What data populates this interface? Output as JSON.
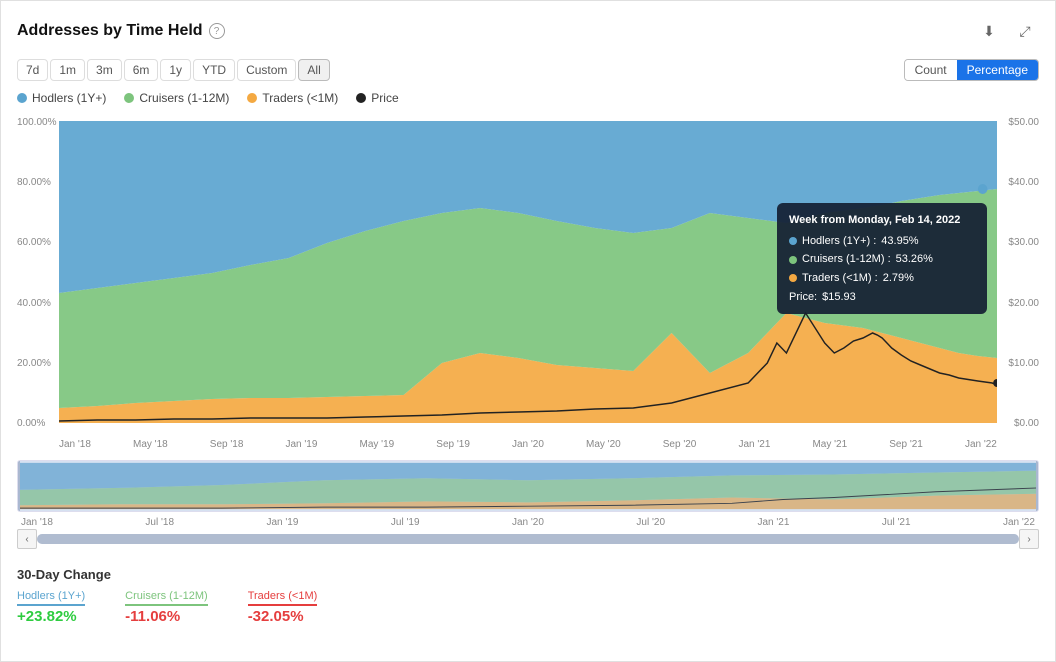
{
  "header": {
    "title": "Addresses by Time Held",
    "help_label": "?",
    "download_icon": "⬇",
    "expand_icon": "⤢"
  },
  "time_filters": [
    {
      "label": "7d",
      "active": false
    },
    {
      "label": "1m",
      "active": false
    },
    {
      "label": "3m",
      "active": false
    },
    {
      "label": "6m",
      "active": false
    },
    {
      "label": "1y",
      "active": false
    },
    {
      "label": "YTD",
      "active": false
    },
    {
      "label": "Custom",
      "active": false
    },
    {
      "label": "All",
      "active": true
    }
  ],
  "view_toggle": {
    "count_label": "Count",
    "percentage_label": "Percentage",
    "active": "Percentage"
  },
  "legend": [
    {
      "label": "Hodlers (1Y+)",
      "color": "#5ba4cf"
    },
    {
      "label": "Cruisers (1-12M)",
      "color": "#7dc47d"
    },
    {
      "label": "Traders (<1M)",
      "color": "#f4a942"
    },
    {
      "label": "Price",
      "color": "#222"
    }
  ],
  "y_axis_left": [
    "100.00%",
    "80.00%",
    "60.00%",
    "40.00%",
    "20.00%",
    "0.00%"
  ],
  "y_axis_right": [
    "$50.00",
    "$40.00",
    "$30.00",
    "$20.00",
    "$10.00",
    "$0.00"
  ],
  "x_axis": [
    "Jan '18",
    "May '18",
    "Sep '18",
    "Jan '19",
    "May '19",
    "Sep '19",
    "Jan '20",
    "May '20",
    "Sep '20",
    "Jan '21",
    "May '21",
    "Sep '21",
    "Jan '22"
  ],
  "tooltip": {
    "title": "Week from Monday, Feb 14, 2022",
    "rows": [
      {
        "label": "Hodlers (1Y+) :",
        "value": "43.95%",
        "color": "#5ba4cf"
      },
      {
        "label": "Cruisers (1-12M) :",
        "value": "53.26%",
        "color": "#7dc47d"
      },
      {
        "label": "Traders (<1M) :",
        "value": "2.79%",
        "color": "#f4a942"
      },
      {
        "label": "Price:",
        "value": "$15.93",
        "color": null
      }
    ]
  },
  "minimap_labels": [
    "Jan '18",
    "Jul '18",
    "Jan '19",
    "Jul '19",
    "Jan '20",
    "Jul '20",
    "Jan '21",
    "Jul '21",
    "Jan '22"
  ],
  "bottom": {
    "section_title": "30-Day Change",
    "items": [
      {
        "label": "Hodlers (1Y+)",
        "color": "#5ba4cf",
        "value": "+23.82%",
        "positive": true
      },
      {
        "label": "Cruisers (1-12M)",
        "color": "#7dc47d",
        "value": "-11.06%",
        "positive": false
      },
      {
        "label": "Traders (<1M)",
        "color": "#e53e3e",
        "value": "-32.05%",
        "positive": false
      }
    ]
  }
}
